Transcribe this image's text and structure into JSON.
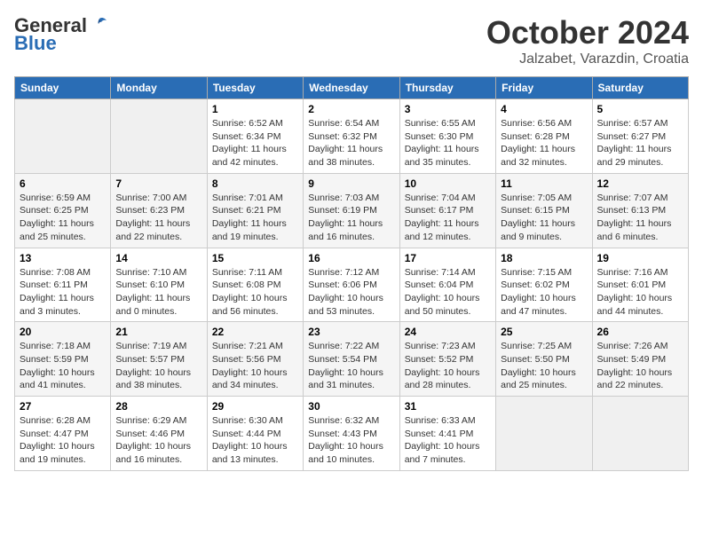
{
  "header": {
    "logo_general": "General",
    "logo_blue": "Blue",
    "month_year": "October 2024",
    "location": "Jalzabet, Varazdin, Croatia"
  },
  "calendar": {
    "days_of_week": [
      "Sunday",
      "Monday",
      "Tuesday",
      "Wednesday",
      "Thursday",
      "Friday",
      "Saturday"
    ],
    "weeks": [
      [
        {
          "day": "",
          "info": ""
        },
        {
          "day": "",
          "info": ""
        },
        {
          "day": "1",
          "info": "Sunrise: 6:52 AM\nSunset: 6:34 PM\nDaylight: 11 hours and 42 minutes."
        },
        {
          "day": "2",
          "info": "Sunrise: 6:54 AM\nSunset: 6:32 PM\nDaylight: 11 hours and 38 minutes."
        },
        {
          "day": "3",
          "info": "Sunrise: 6:55 AM\nSunset: 6:30 PM\nDaylight: 11 hours and 35 minutes."
        },
        {
          "day": "4",
          "info": "Sunrise: 6:56 AM\nSunset: 6:28 PM\nDaylight: 11 hours and 32 minutes."
        },
        {
          "day": "5",
          "info": "Sunrise: 6:57 AM\nSunset: 6:27 PM\nDaylight: 11 hours and 29 minutes."
        }
      ],
      [
        {
          "day": "6",
          "info": "Sunrise: 6:59 AM\nSunset: 6:25 PM\nDaylight: 11 hours and 25 minutes."
        },
        {
          "day": "7",
          "info": "Sunrise: 7:00 AM\nSunset: 6:23 PM\nDaylight: 11 hours and 22 minutes."
        },
        {
          "day": "8",
          "info": "Sunrise: 7:01 AM\nSunset: 6:21 PM\nDaylight: 11 hours and 19 minutes."
        },
        {
          "day": "9",
          "info": "Sunrise: 7:03 AM\nSunset: 6:19 PM\nDaylight: 11 hours and 16 minutes."
        },
        {
          "day": "10",
          "info": "Sunrise: 7:04 AM\nSunset: 6:17 PM\nDaylight: 11 hours and 12 minutes."
        },
        {
          "day": "11",
          "info": "Sunrise: 7:05 AM\nSunset: 6:15 PM\nDaylight: 11 hours and 9 minutes."
        },
        {
          "day": "12",
          "info": "Sunrise: 7:07 AM\nSunset: 6:13 PM\nDaylight: 11 hours and 6 minutes."
        }
      ],
      [
        {
          "day": "13",
          "info": "Sunrise: 7:08 AM\nSunset: 6:11 PM\nDaylight: 11 hours and 3 minutes."
        },
        {
          "day": "14",
          "info": "Sunrise: 7:10 AM\nSunset: 6:10 PM\nDaylight: 11 hours and 0 minutes."
        },
        {
          "day": "15",
          "info": "Sunrise: 7:11 AM\nSunset: 6:08 PM\nDaylight: 10 hours and 56 minutes."
        },
        {
          "day": "16",
          "info": "Sunrise: 7:12 AM\nSunset: 6:06 PM\nDaylight: 10 hours and 53 minutes."
        },
        {
          "day": "17",
          "info": "Sunrise: 7:14 AM\nSunset: 6:04 PM\nDaylight: 10 hours and 50 minutes."
        },
        {
          "day": "18",
          "info": "Sunrise: 7:15 AM\nSunset: 6:02 PM\nDaylight: 10 hours and 47 minutes."
        },
        {
          "day": "19",
          "info": "Sunrise: 7:16 AM\nSunset: 6:01 PM\nDaylight: 10 hours and 44 minutes."
        }
      ],
      [
        {
          "day": "20",
          "info": "Sunrise: 7:18 AM\nSunset: 5:59 PM\nDaylight: 10 hours and 41 minutes."
        },
        {
          "day": "21",
          "info": "Sunrise: 7:19 AM\nSunset: 5:57 PM\nDaylight: 10 hours and 38 minutes."
        },
        {
          "day": "22",
          "info": "Sunrise: 7:21 AM\nSunset: 5:56 PM\nDaylight: 10 hours and 34 minutes."
        },
        {
          "day": "23",
          "info": "Sunrise: 7:22 AM\nSunset: 5:54 PM\nDaylight: 10 hours and 31 minutes."
        },
        {
          "day": "24",
          "info": "Sunrise: 7:23 AM\nSunset: 5:52 PM\nDaylight: 10 hours and 28 minutes."
        },
        {
          "day": "25",
          "info": "Sunrise: 7:25 AM\nSunset: 5:50 PM\nDaylight: 10 hours and 25 minutes."
        },
        {
          "day": "26",
          "info": "Sunrise: 7:26 AM\nSunset: 5:49 PM\nDaylight: 10 hours and 22 minutes."
        }
      ],
      [
        {
          "day": "27",
          "info": "Sunrise: 6:28 AM\nSunset: 4:47 PM\nDaylight: 10 hours and 19 minutes."
        },
        {
          "day": "28",
          "info": "Sunrise: 6:29 AM\nSunset: 4:46 PM\nDaylight: 10 hours and 16 minutes."
        },
        {
          "day": "29",
          "info": "Sunrise: 6:30 AM\nSunset: 4:44 PM\nDaylight: 10 hours and 13 minutes."
        },
        {
          "day": "30",
          "info": "Sunrise: 6:32 AM\nSunset: 4:43 PM\nDaylight: 10 hours and 10 minutes."
        },
        {
          "day": "31",
          "info": "Sunrise: 6:33 AM\nSunset: 4:41 PM\nDaylight: 10 hours and 7 minutes."
        },
        {
          "day": "",
          "info": ""
        },
        {
          "day": "",
          "info": ""
        }
      ]
    ]
  }
}
